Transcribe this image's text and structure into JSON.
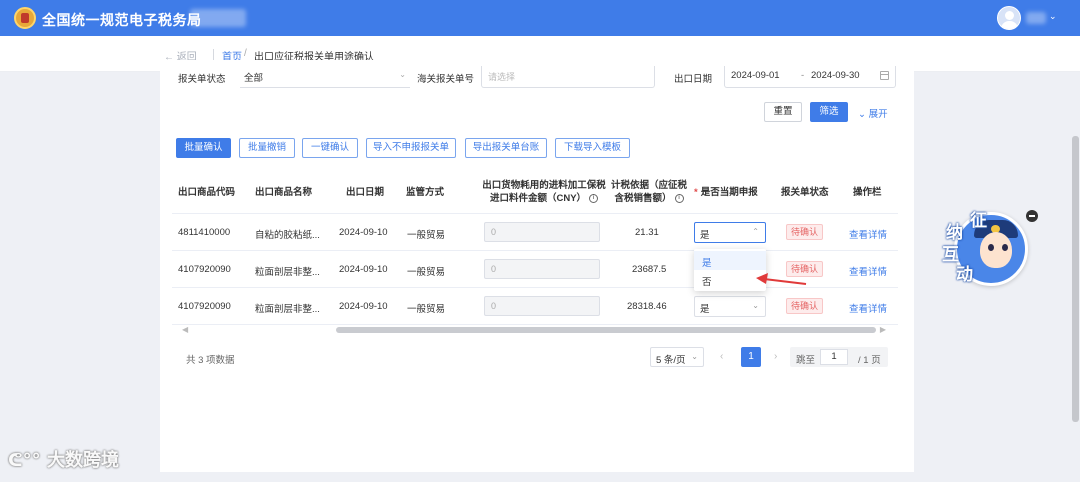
{
  "header": {
    "app_title": "全国统一规范电子税务局"
  },
  "breadcrumb": {
    "back": "← 返回",
    "home": "首页",
    "separator": "/",
    "current": "出口应征税报关单用途确认"
  },
  "filters": {
    "status_label": "报关单状态",
    "status_value": "全部",
    "customs_no_label": "海关报关单号",
    "customs_no_placeholder": "请选择",
    "export_date_label": "出口日期",
    "date_start": "2024-09-01",
    "date_dash": "-",
    "date_end": "2024-09-30"
  },
  "actions": {
    "reset": "重置",
    "filter": "筛选",
    "expand": "展开",
    "batch_confirm": "批量确认",
    "batch_revoke": "批量撤销",
    "one_click_confirm": "一键确认",
    "import_unreported": "导入不申报报关单",
    "export_ledger": "导出报关单台账",
    "download_template": "下载导入模板"
  },
  "table": {
    "headers": {
      "code": "出口商品代码",
      "name": "出口商品名称",
      "date": "出口日期",
      "mode": "监管方式",
      "bonded_line1": "出口货物耗用的进料加工保税",
      "bonded_line2": "进口料件金额（CNY）",
      "tax_line1": "计税依据（应征税",
      "tax_line2": "含税销售额）",
      "declare": "是否当期申报",
      "required_mark": "*",
      "status": "报关单状态",
      "operation": "操作栏"
    },
    "rows": [
      {
        "code": "4811410000",
        "name": "自粘的胶粘纸...",
        "date": "2024-09-10",
        "mode": "一般贸易",
        "bonded": "0",
        "tax_base": "21.31",
        "declare": "是",
        "status": "待确认",
        "op": "查看详情"
      },
      {
        "code": "4107920090",
        "name": "粒面剖层非整...",
        "date": "2024-09-10",
        "mode": "一般贸易",
        "bonded": "0",
        "tax_base": "23687.5",
        "declare": "是",
        "status": "待确认",
        "op": "查看详情"
      },
      {
        "code": "4107920090",
        "name": "粒面剖层非整...",
        "date": "2024-09-10",
        "mode": "一般贸易",
        "bonded": "0",
        "tax_base": "28318.46",
        "declare": "是",
        "status": "待确认",
        "op": "查看详情"
      }
    ],
    "dropdown_options": [
      "是",
      "否"
    ]
  },
  "pagination": {
    "total": "共 3 项数据",
    "page_size": "5 条/页",
    "current_page": "1",
    "jump_prefix": "跳至",
    "jump_value": "1",
    "jump_suffix": "/ 1 页"
  },
  "mascot": {
    "chars": [
      "纳",
      "征",
      "互",
      "动"
    ]
  },
  "watermark": {
    "text": "大数跨境"
  },
  "colors": {
    "primary": "#3f7ce8",
    "status_pending": "#e56464",
    "arrow": "#e03a3a"
  }
}
